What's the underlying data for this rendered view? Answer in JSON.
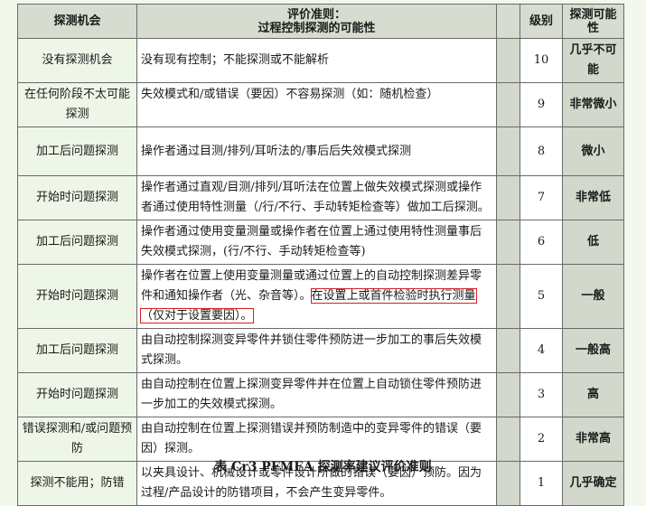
{
  "header": {
    "opportunity": "探测机会",
    "criteria_line1": "评价准则：",
    "criteria_line2": "过程控制探测的可能性",
    "rank": "级别",
    "likelihood": "探测可能性"
  },
  "rows": [
    {
      "opportunity": "没有探测机会",
      "criteria": "没有现有控制；不能探测或不能解析",
      "rank": "10",
      "likelihood": "几乎不可能"
    },
    {
      "opportunity": "在任何阶段不太可能探测",
      "criteria": "失效模式和/或错误（要因）不容易探测（如：随机检查）",
      "rank": "9",
      "likelihood": "非常微小"
    },
    {
      "opportunity": "加工后问题探测",
      "criteria": "操作者通过目测/排列/耳听法的/事后后失效模式探测",
      "rank": "8",
      "likelihood": "微小"
    },
    {
      "opportunity": "开始时问题探测",
      "criteria": "操作者通过直观/目测/排列/耳听法在位置上做失效模式探测或操作者通过使用特性测量（/行/不行、手动转矩检查等）做加工后探测。",
      "rank": "7",
      "likelihood": "非常低"
    },
    {
      "opportunity": "加工后问题探测",
      "criteria": "操作者通过使用变量测量或操作者在位置上通过使用特性测量事后失效模式探测，(行/不行、手动转矩检查等)",
      "rank": "6",
      "likelihood": "低"
    },
    {
      "opportunity": "开始时问题探测",
      "criteria_pre": "操作者在位置上使用变量测量或通过位置上的自动控制探测差异零件和通知操作者（光、杂音等）。",
      "criteria_highlight": "在设置上或首件检验时执行测量（仅对于设置要因）。",
      "rank": "5",
      "likelihood": "一般"
    },
    {
      "opportunity": "加工后问题探测",
      "criteria": "由自动控制探测变异零件并锁住零件预防进一步加工的事后失效模式探测。",
      "rank": "4",
      "likelihood": "一般高"
    },
    {
      "opportunity": "开始时问题探测",
      "criteria": "由自动控制在位置上探测变异零件并在位置上自动锁住零件预防进一步加工的失效模式探测。",
      "rank": "3",
      "likelihood": "高"
    },
    {
      "opportunity": "错误探测和/或问题预防",
      "criteria": "由自动控制在位置上探测错误并预防制造中的变异零件的错误（要因）探测。",
      "rank": "2",
      "likelihood": "非常高"
    },
    {
      "opportunity": "探测不能用；防错",
      "criteria": "以夹具设计、机械设计或零件设计所做的错误（要因）预防。因为过程/产品设计的防错项目，不会产生变异零件。",
      "rank": "1",
      "likelihood": "几乎确定"
    }
  ],
  "caption": "表 Cr3 PFMEA 探测率建议评价准则"
}
